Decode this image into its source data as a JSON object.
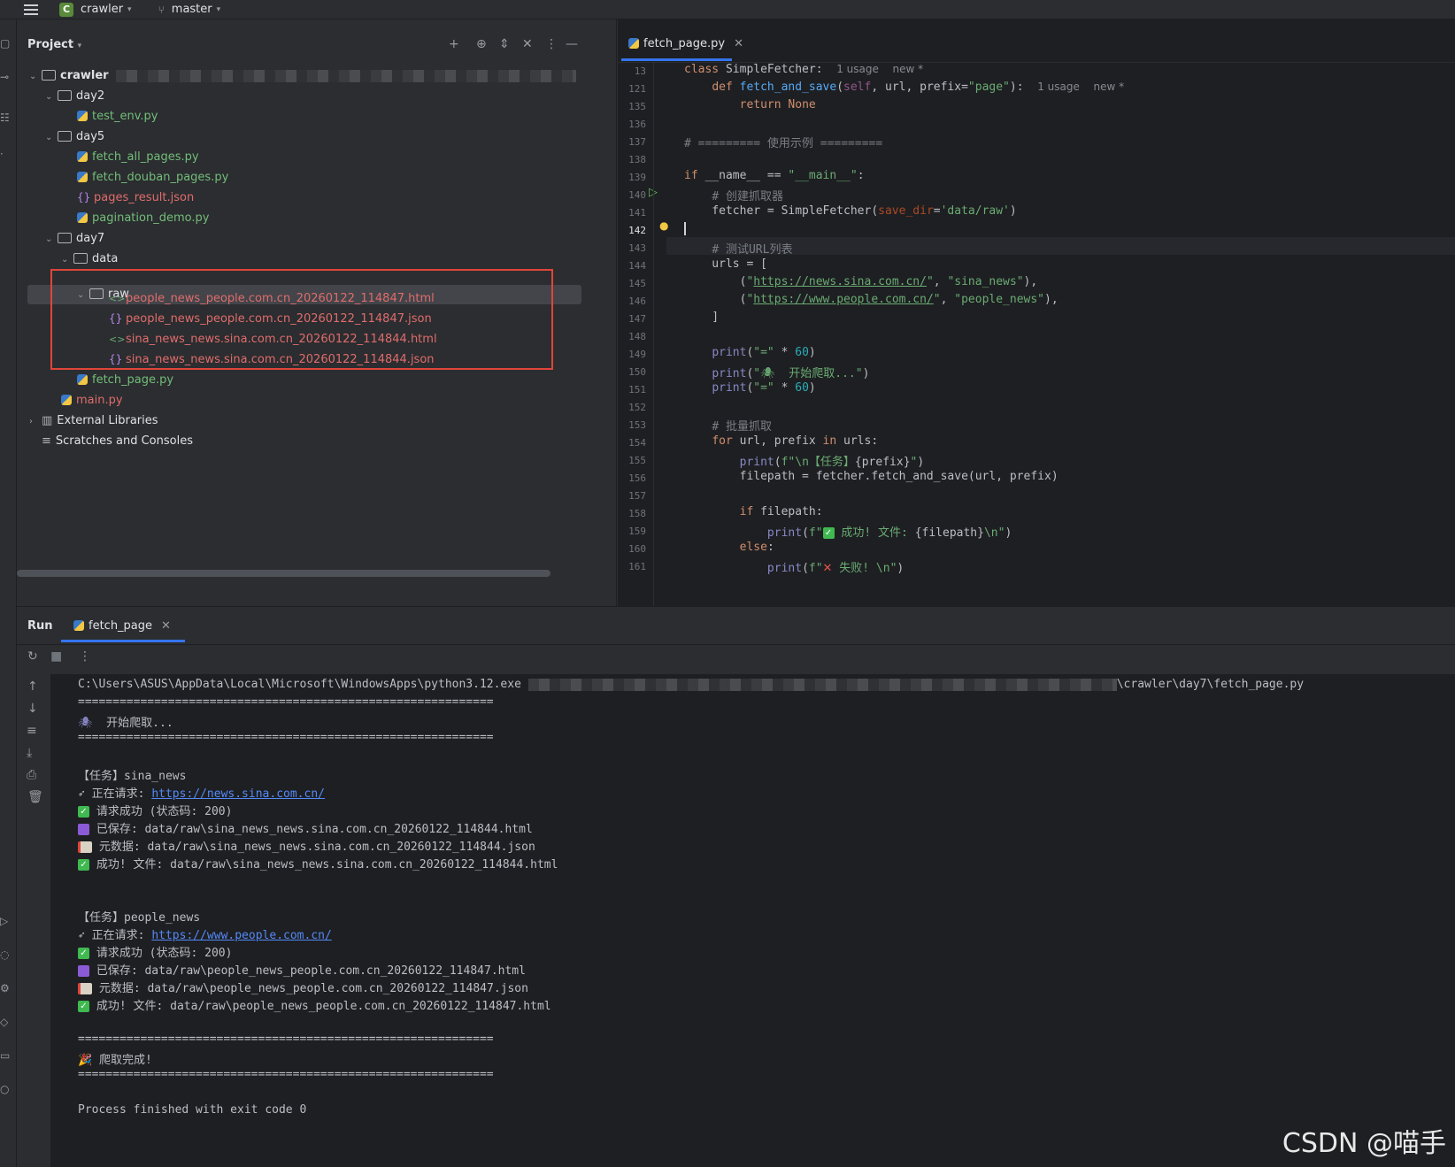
{
  "topbar": {
    "project_badge": "C",
    "project_name": "crawler",
    "branch": "master"
  },
  "project_panel": {
    "title": "Project",
    "tree": [
      {
        "label": "crawler",
        "kind": "folder",
        "open": true,
        "level": 0
      },
      {
        "label": "day2",
        "kind": "folder",
        "open": true,
        "level": 1
      },
      {
        "label": "test_env.py",
        "kind": "py",
        "level": 2
      },
      {
        "label": "day5",
        "kind": "folder",
        "open": true,
        "level": 1
      },
      {
        "label": "fetch_all_pages.py",
        "kind": "py",
        "level": 2
      },
      {
        "label": "fetch_douban_pages.py",
        "kind": "py",
        "level": 2
      },
      {
        "label": "pages_result.json",
        "kind": "json",
        "level": 2
      },
      {
        "label": "pagination_demo.py",
        "kind": "py",
        "level": 2
      },
      {
        "label": "day7",
        "kind": "folder",
        "open": true,
        "level": 1
      },
      {
        "label": "data",
        "kind": "folder",
        "open": true,
        "level": 2
      },
      {
        "label": "raw",
        "kind": "folder",
        "open": true,
        "level": 3
      },
      {
        "label": "people_news_people.com.cn_20260122_114847.html",
        "kind": "html",
        "level": 4
      },
      {
        "label": "people_news_people.com.cn_20260122_114847.json",
        "kind": "json",
        "level": 4
      },
      {
        "label": "sina_news_news.sina.com.cn_20260122_114844.html",
        "kind": "html",
        "level": 4
      },
      {
        "label": "sina_news_news.sina.com.cn_20260122_114844.json",
        "kind": "json",
        "level": 4
      },
      {
        "label": "fetch_page.py",
        "kind": "py",
        "level": 2
      },
      {
        "label": "main.py",
        "kind": "py",
        "level": 1
      },
      {
        "label": "External Libraries",
        "kind": "lib",
        "level": 0
      },
      {
        "label": "Scratches and Consoles",
        "kind": "scratch",
        "level": 0
      }
    ]
  },
  "editor": {
    "tab_label": "fetch_page.py",
    "current_line": "142",
    "line_numbers": [
      "13",
      "121",
      "135",
      "136",
      "137",
      "138",
      "139",
      "140",
      "141",
      "142",
      "143",
      "144",
      "145",
      "146",
      "147",
      "148",
      "149",
      "150",
      "151",
      "152",
      "153",
      "154",
      "155",
      "156",
      "157",
      "158",
      "159",
      "160",
      "161"
    ],
    "hints": {
      "usage": "1 usage",
      "new": "new *"
    }
  },
  "run_panel": {
    "title": "Run",
    "tab_label": "fetch_page",
    "command_prefix": "C:\\Users\\ASUS\\AppData\\Local\\Microsoft\\WindowsApps\\python3.12.exe",
    "command_suffix": "\\crawler\\day7\\fetch_page.py",
    "sep": "============================================================",
    "start": "开始爬取...",
    "task1": "【任务】sina_news",
    "req1_label": "正在请求: ",
    "req1_url": "https://news.sina.com.cn/",
    "ok1": "请求成功 (状态码: 200)",
    "saved1": "已保存: data/raw\\sina_news_news.sina.com.cn_20260122_114844.html",
    "meta1": "元数据: data/raw\\sina_news_news.sina.com.cn_20260122_114844.json",
    "done1": "成功! 文件: data/raw\\sina_news_news.sina.com.cn_20260122_114844.html",
    "task2": "【任务】people_news",
    "req2_label": "正在请求: ",
    "req2_url": "https://www.people.com.cn/",
    "ok2": "请求成功 (状态码: 200)",
    "saved2": "已保存: data/raw\\people_news_people.com.cn_20260122_114847.html",
    "meta2": "元数据: data/raw\\people_news_people.com.cn_20260122_114847.json",
    "done2": "成功! 文件: data/raw\\people_news_people.com.cn_20260122_114847.html",
    "finish": "爬取完成!",
    "exit": "Process finished with exit code 0"
  },
  "watermark": "CSDN @喵手"
}
